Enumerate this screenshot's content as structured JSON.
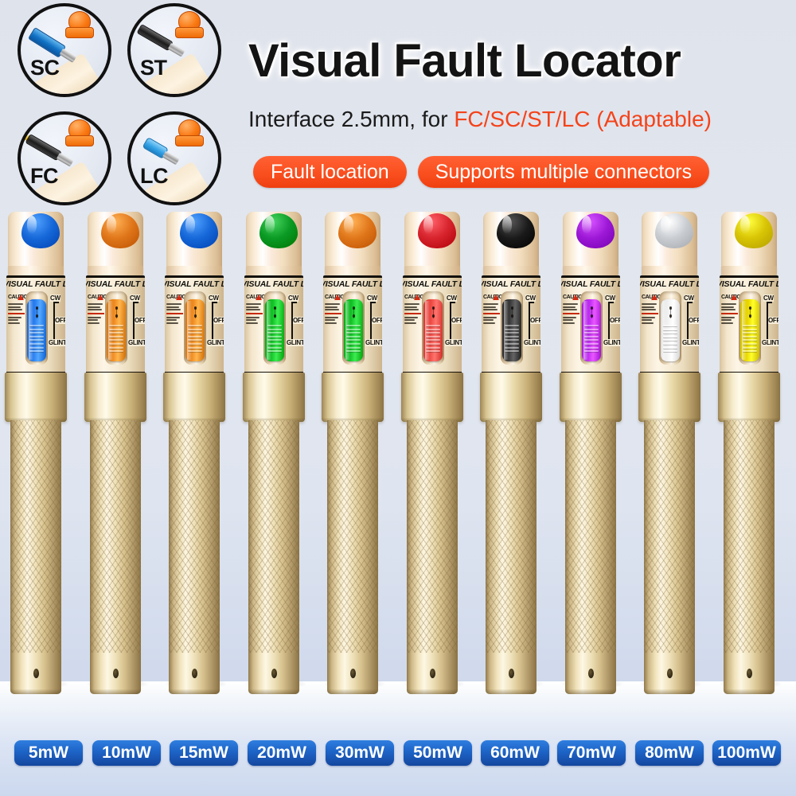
{
  "headline": "Visual Fault Locator",
  "subline": {
    "prefix": "Interface 2.5mm, for ",
    "highlight": "FC/SC/ST/LC (Adaptable)"
  },
  "pills": [
    "Fault location",
    "Supports multiple connectors"
  ],
  "connector_badges": [
    {
      "label": "SC",
      "connector_color": "#1272c4"
    },
    {
      "label": "ST",
      "connector_color": "#1c1c1c"
    },
    {
      "label": "FC",
      "connector_color": "#1c1c1c"
    },
    {
      "label": "LC",
      "connector_color": "#35a2e6"
    }
  ],
  "pen_label": {
    "title": "VISUAL FAULT LOCATOR",
    "warning_head": "CAUTION",
    "modes": [
      "CW",
      "OFF",
      "GLINT"
    ]
  },
  "pens": [
    {
      "dome": "blue",
      "dome_color": "#1667d8",
      "switch_color": "#2a7ef0"
    },
    {
      "dome": "orange",
      "dome_color": "#e0761a",
      "switch_color": "#ef8b22"
    },
    {
      "dome": "blue",
      "dome_color": "#1667d8",
      "switch_color": "#ef8b22"
    },
    {
      "dome": "green",
      "dome_color": "#0a9a24",
      "switch_color": "#13c227"
    },
    {
      "dome": "orange",
      "dome_color": "#e0761a",
      "switch_color": "#13c227"
    },
    {
      "dome": "red",
      "dome_color": "#d6232c",
      "switch_color": "#ee4a44"
    },
    {
      "dome": "black",
      "dome_color": "#1a1a1a",
      "switch_color": "#3a3a3a"
    },
    {
      "dome": "purple",
      "dome_color": "#9c18d6",
      "switch_color": "#bf2df2"
    },
    {
      "dome": "silver",
      "dome_color": "#c9cdd2",
      "switch_color": "#f2f2f2"
    },
    {
      "dome": "yellow",
      "dome_color": "#d8c404",
      "switch_color": "#ead700"
    }
  ],
  "power_options": [
    "5mW",
    "10mW",
    "15mW",
    "20mW",
    "30mW",
    "50mW",
    "60mW",
    "70mW",
    "80mW",
    "100mW"
  ],
  "colors": {
    "background": "#dfe3ec",
    "accent_orange": "#f4431a",
    "badge_blue": "#1d63c6",
    "pen_body_gold": "#e6d3a2",
    "cap_cream": "#fbeada"
  }
}
